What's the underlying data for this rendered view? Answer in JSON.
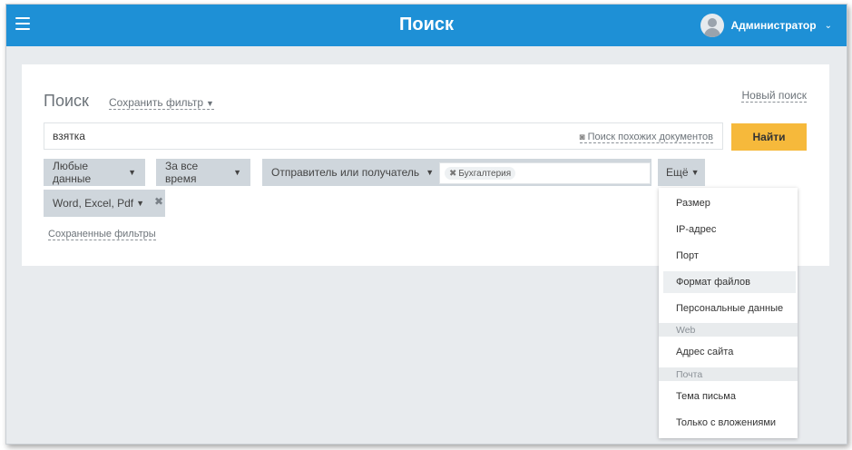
{
  "header": {
    "title": "Поиск",
    "user_name": "Администратор",
    "user_caret": "⌄"
  },
  "card": {
    "title": "Поиск",
    "save_filter_label": "Сохранить фильтр",
    "new_search_label": "Новый поиск"
  },
  "search": {
    "value": "взятка",
    "similar_label": "Поиск похожих документов",
    "find_label": "Найти"
  },
  "filters": {
    "any_data": "Любые данные",
    "all_time": "За все время",
    "sender_recipient": "Отправитель или получатель",
    "recipient_tag": "Бухгалтерия",
    "more": "Ещё",
    "file_formats": "Word, Excel, Pdf",
    "saved_filters": "Сохраненные фильтры"
  },
  "dropdown": {
    "items": [
      "Размер",
      "IP-адрес",
      "Порт",
      "Формат файлов",
      "Персональные данные"
    ],
    "group_web": "Web",
    "web_items": [
      "Адрес сайта"
    ],
    "group_mail": "Почта",
    "mail_items": [
      "Тема письма",
      "Только с вложениями"
    ],
    "active_item": "Формат файлов"
  },
  "colors": {
    "topbar": "#1e90d6",
    "find_button": "#f6b93b",
    "chip": "#cfd6dc"
  },
  "icons": {
    "menu": "hamburger-icon",
    "avatar": "user-avatar-icon",
    "similar": "binoculars-icon",
    "remove": "close-icon",
    "caret": "caret-down-icon"
  }
}
